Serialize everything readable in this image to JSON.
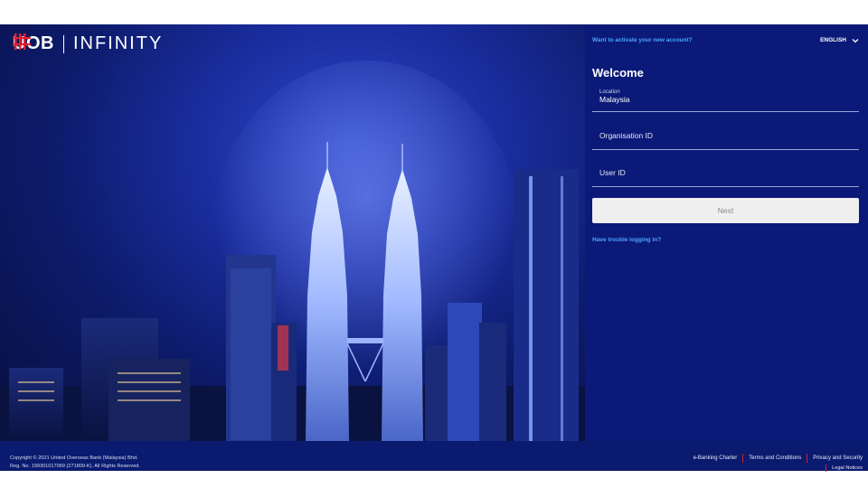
{
  "brand": {
    "name": "UOB",
    "product": "INFINITY"
  },
  "header": {
    "activate_link": "Want to activate your new account?",
    "language": "ENGLISH"
  },
  "form": {
    "welcome": "Welcome",
    "location_label": "Location",
    "location_value": "Malaysia",
    "org_id_placeholder": "Organisation ID",
    "user_id_placeholder": "User ID",
    "next_label": "Next",
    "trouble_link": "Have trouble logging in?"
  },
  "footer": {
    "copyright_line1": "Copyright © 2021 United Overseas Bank (Malaysia) Bhd.",
    "copyright_line2": "Reg. No. 199301017069 (271809-K). All Rights Reserved.",
    "links": [
      "e-Banking Charter",
      "Terms and Conditions",
      "Privacy and Security"
    ],
    "legal": "Legal Notices"
  },
  "colors": {
    "panel_bg": "#0b1a78",
    "link_blue": "#4ea3ff",
    "brand_red": "#e4202f",
    "button_bg": "#efefef"
  },
  "icons": [
    "uob-logo-mark-icon",
    "chevron-down-icon"
  ]
}
